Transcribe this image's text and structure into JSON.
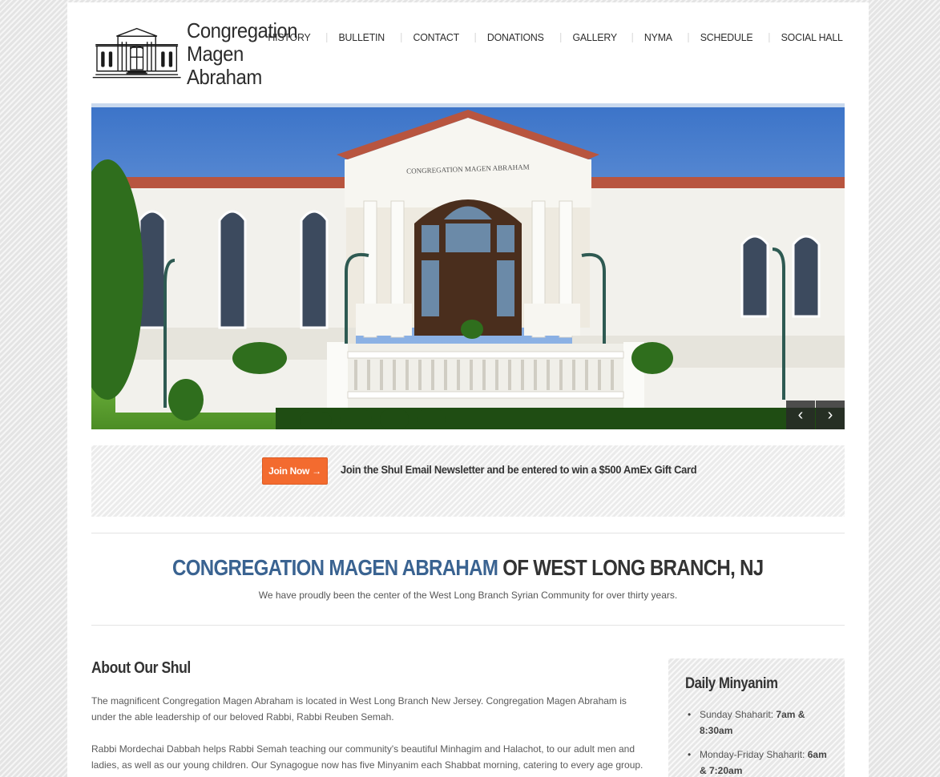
{
  "header": {
    "logo_line1": "Congregation",
    "logo_line2": "Magen Abraham"
  },
  "nav": {
    "items": [
      "HISTORY",
      "BULLETIN",
      "CONTACT",
      "DONATIONS",
      "GALLERY",
      "NYMA",
      "SCHEDULE",
      "SOCIAL HALL"
    ]
  },
  "hero": {
    "building_inscription": "CONGREGATION MAGEN ABRAHAM",
    "prev_icon": "chevron-left-icon",
    "next_icon": "chevron-right-icon"
  },
  "banner": {
    "button_label": "Join Now →",
    "text": "Join the Shul Email Newsletter and be entered to win a $500 AmEx Gift Card",
    "button_color": "#f36b2f"
  },
  "intro": {
    "title_highlight": "CONGREGATION MAGEN ABRAHAM",
    "title_rest": " OF WEST LONG BRANCH, NJ",
    "subtitle": "We have proudly been the center of the West Long Branch Syrian Community for over thirty years.",
    "highlight_color": "#3a6391"
  },
  "about": {
    "title": "About Our Shul",
    "paragraph1": "The magnificent Congregation Magen Abraham is located in West Long Branch New Jersey. Congregation Magen Abraham is under the able leadership of our beloved Rabbi, Rabbi Reuben Semah.",
    "paragraph2": "Rabbi Mordechai Dabbah helps Rabbi Semah teaching our community's beautiful Minhagim and Halachot, to our adult men and ladies, as well as our young children. Our Synagogue now has five Minyanim each Shabbat morning, catering to every age group."
  },
  "sidebar": {
    "title": "Daily Minyanim",
    "items": [
      {
        "label": "Sunday Shaharit: ",
        "time": "7am & 8:30am"
      },
      {
        "label": "Monday-Friday Shaharit: ",
        "time": "6am & 7:20am"
      }
    ]
  }
}
